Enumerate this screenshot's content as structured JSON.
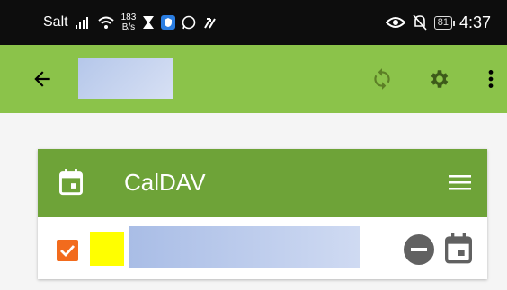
{
  "status_bar": {
    "carrier": "Salt",
    "net_speed_value": "183",
    "net_speed_unit": "B/s",
    "battery": "81",
    "time": "4:37"
  },
  "app_bar": {
    "back_icon": "arrow-back",
    "sync_icon": "sync",
    "settings_icon": "gear",
    "more_icon": "more-vert",
    "color": "#8bc34a"
  },
  "card": {
    "title": "CalDAV",
    "header_color": "#6ea338",
    "header_icon": "calendar",
    "menu_icon": "hamburger-menu",
    "rows": [
      {
        "checked": true,
        "color": "#ffff00",
        "action_icons": [
          "remove-circle",
          "calendar"
        ]
      }
    ]
  }
}
